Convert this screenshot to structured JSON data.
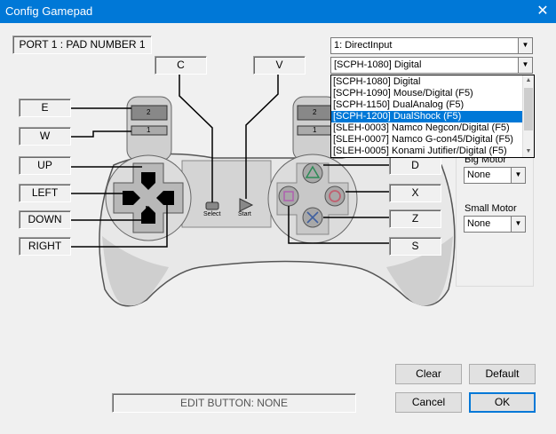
{
  "window": {
    "title": "Config Gamepad",
    "close_icon": "✕"
  },
  "port_label": "PORT 1 : PAD NUMBER 1",
  "input_select": {
    "value": "1: DirectInput"
  },
  "pad_type_select": {
    "value": "[SCPH-1080] Digital",
    "options": [
      "[SCPH-1080] Digital",
      "[SCPH-1090] Mouse/Digital (F5)",
      "[SCPH-1150] DualAnalog (F5)",
      "[SCPH-1200] DualShock (F5)",
      "[SLEH-0003] Namco Negcon/Digital (F5)",
      "[SLEH-0007] Namco G-con45/Digital (F5)",
      "[SLEH-0005] Konami Jutifier/Digital (F5)"
    ],
    "selected_index": 3
  },
  "bindings": {
    "select": "C",
    "start": "V",
    "l2": "E",
    "l1": "W",
    "up": "UP",
    "left": "LEFT",
    "down": "DOWN",
    "right": "RIGHT",
    "triangle": "D",
    "circle": "X",
    "cross": "Z",
    "square": "S"
  },
  "pad_labels": {
    "select": "Select",
    "start": "Start",
    "l2": "2",
    "l1": "1",
    "r2": "2",
    "r1": "1"
  },
  "motors": {
    "big": {
      "label": "Big Motor",
      "value": "None"
    },
    "small": {
      "label": "Small Motor",
      "value": "None"
    }
  },
  "status": "EDIT BUTTON: NONE",
  "buttons": {
    "clear": "Clear",
    "default": "Default",
    "cancel": "Cancel",
    "ok": "OK"
  }
}
